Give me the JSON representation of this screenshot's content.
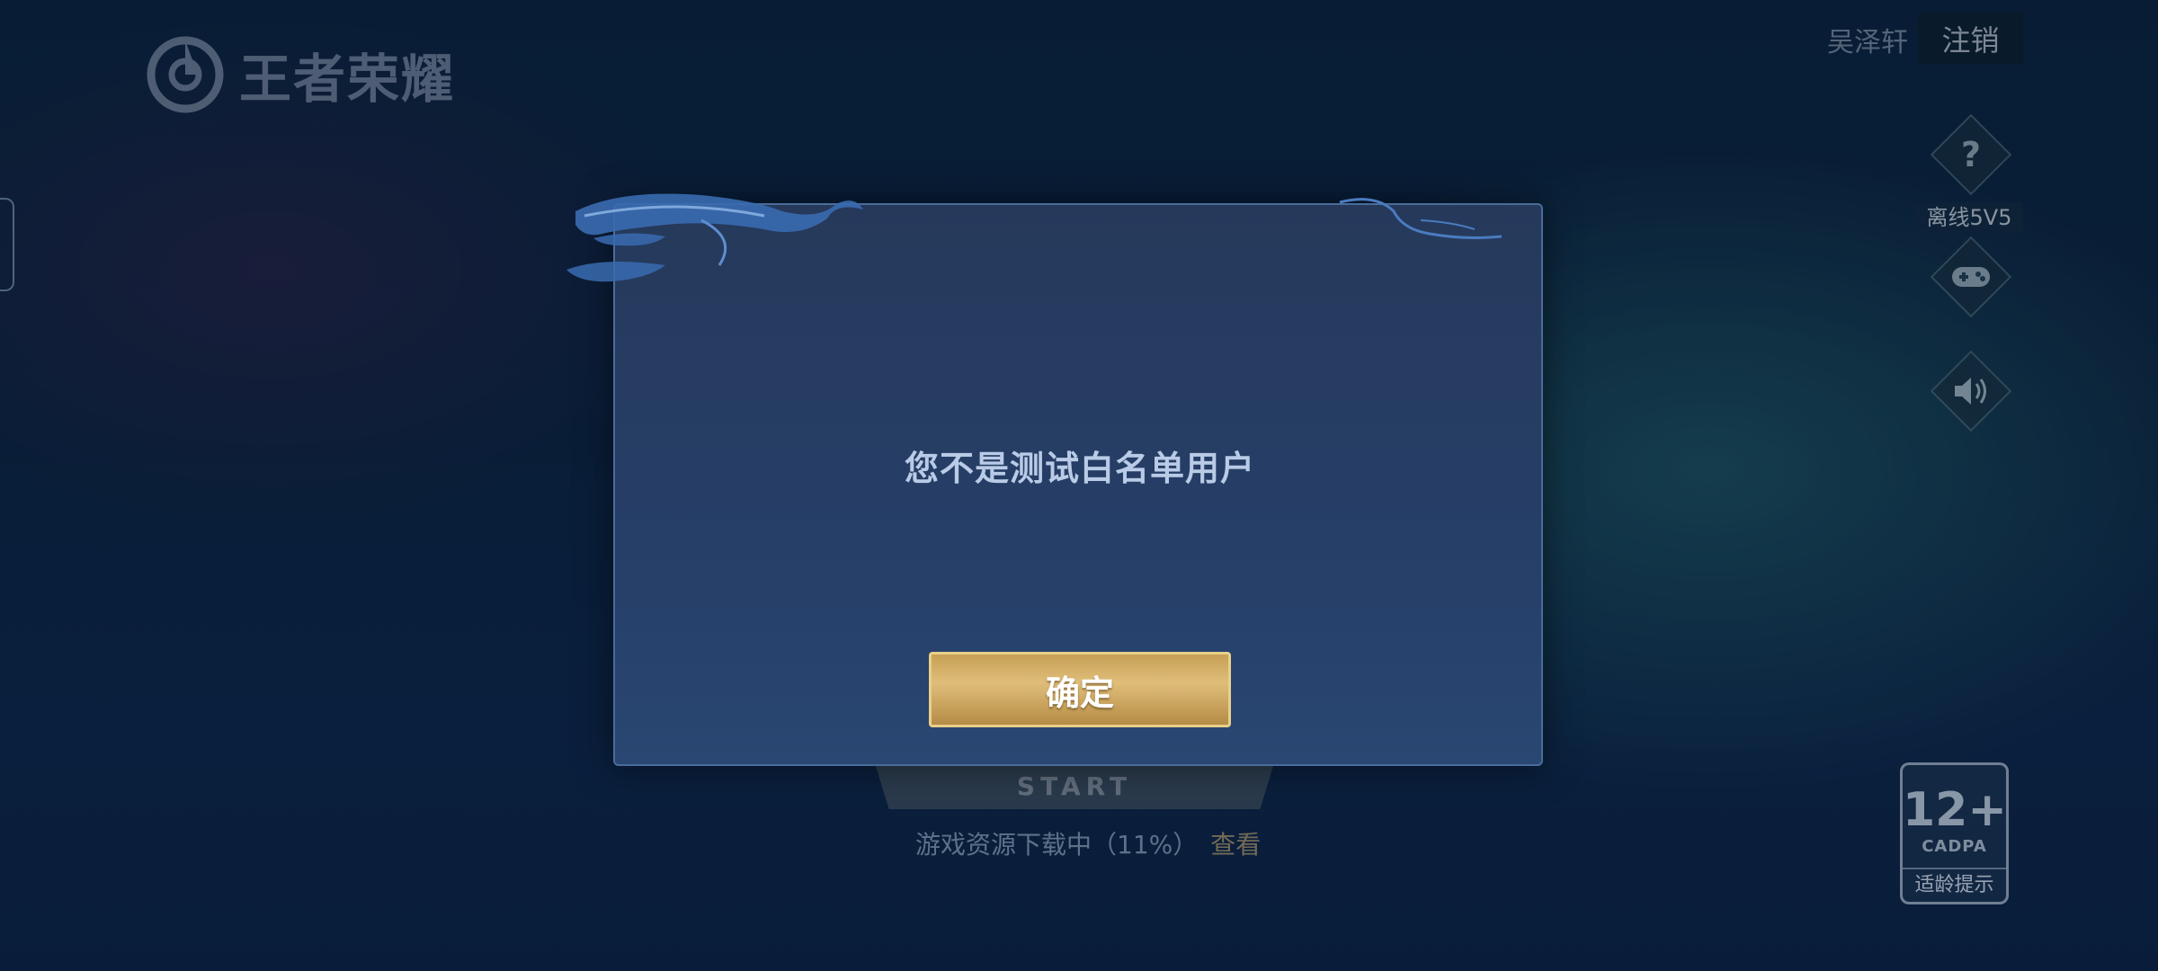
{
  "app": {
    "logo_text": "王者荣耀"
  },
  "header": {
    "user_name": "吴泽轩",
    "logout_label": "注销"
  },
  "side_menu": {
    "help_glyph": "?",
    "offline_label": "离线5V5",
    "icons": [
      "help-icon",
      "gamepad-icon",
      "speaker-icon"
    ]
  },
  "start": {
    "label": "START"
  },
  "download": {
    "status": "游戏资源下载中（11%）",
    "progress": 0.11,
    "view_link": "查看"
  },
  "age_rating": {
    "age": "12+",
    "org": "CADPA",
    "hint": "适龄提示"
  },
  "dialog": {
    "message": "您不是测试白名单用户",
    "confirm_label": "确定"
  },
  "colors": {
    "dialog_bg": "#26395b",
    "dialog_border": "#4a6c9a",
    "button_gold": "#c79f55",
    "message_text": "#b9cbe6"
  }
}
